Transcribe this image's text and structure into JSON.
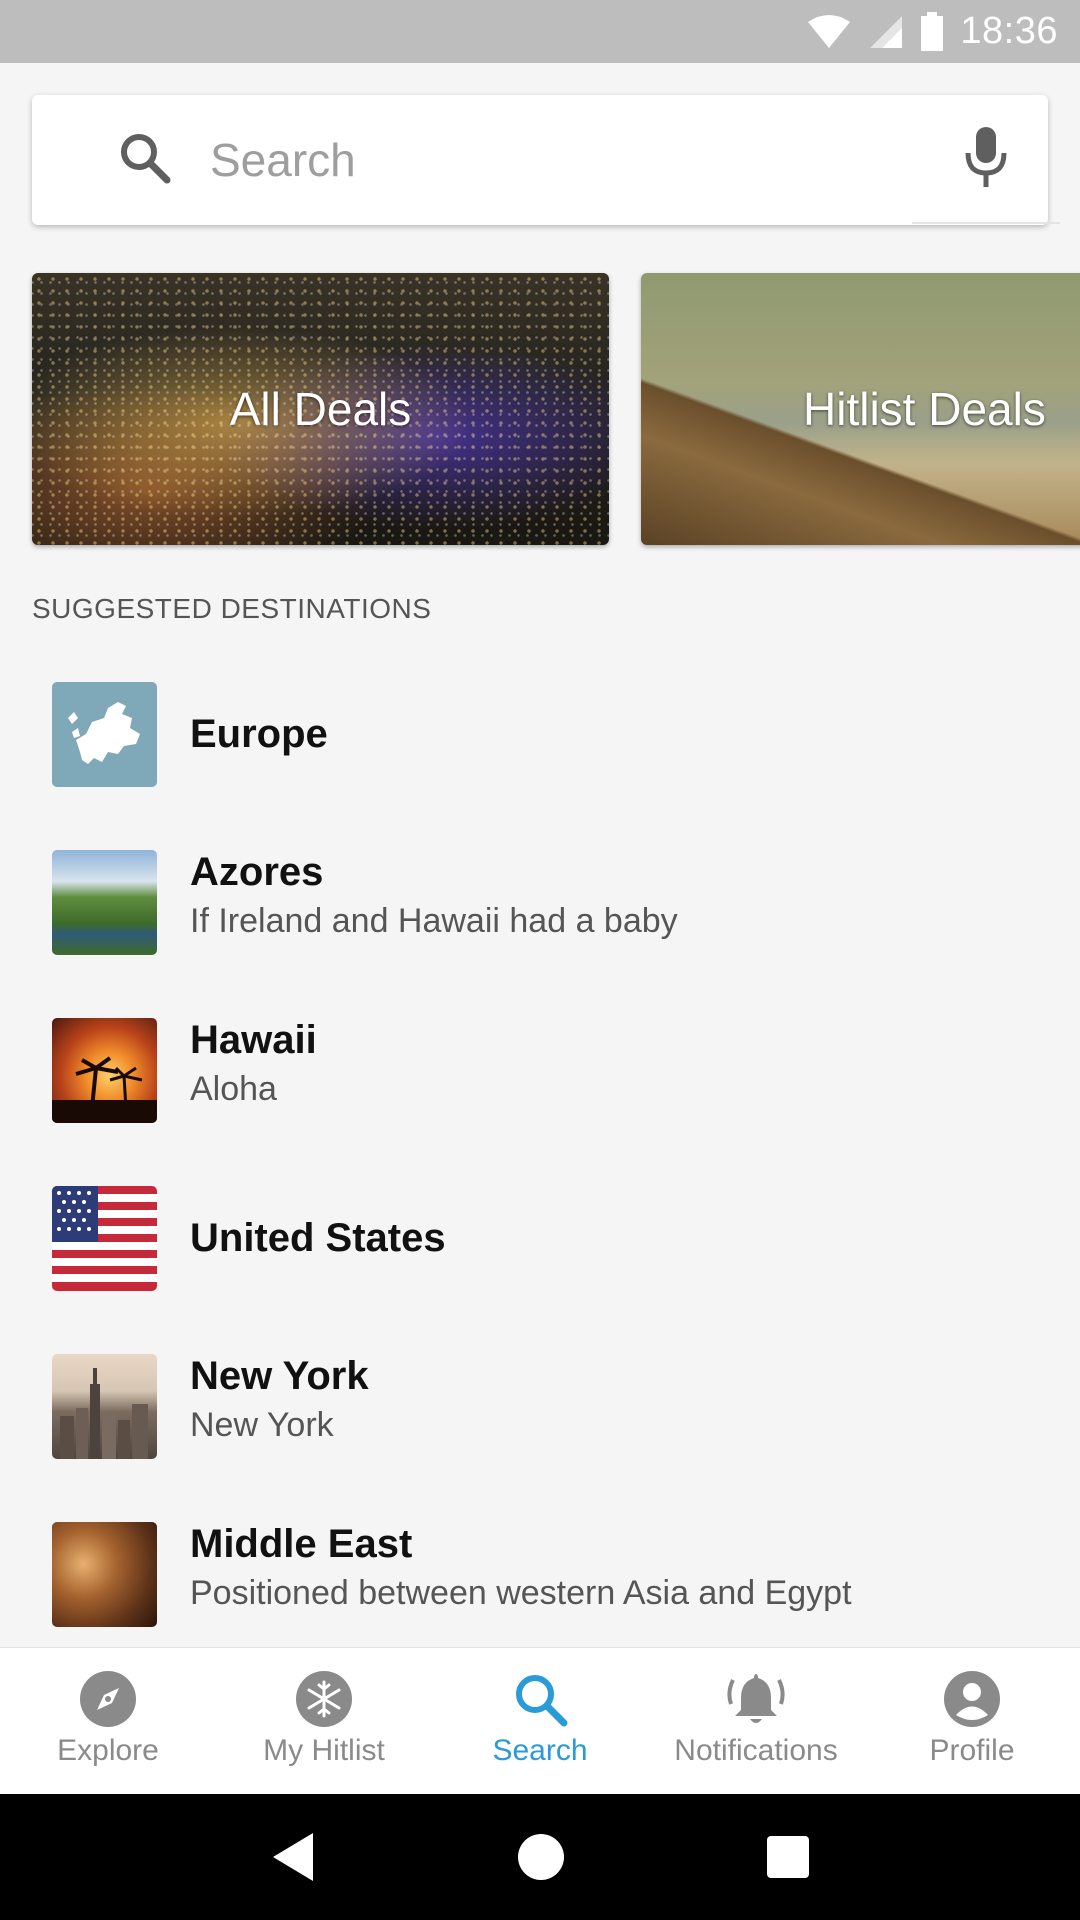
{
  "status_bar": {
    "time": "18:36"
  },
  "search": {
    "placeholder": "Search"
  },
  "deals": [
    {
      "label": "All Deals"
    },
    {
      "label": "Hitlist Deals"
    }
  ],
  "section_title": "SUGGESTED DESTINATIONS",
  "destinations": [
    {
      "name": "Europe",
      "subtitle": ""
    },
    {
      "name": "Azores",
      "subtitle": "If Ireland and Hawaii had a baby"
    },
    {
      "name": "Hawaii",
      "subtitle": "Aloha"
    },
    {
      "name": "United States",
      "subtitle": ""
    },
    {
      "name": "New York",
      "subtitle": "New York"
    },
    {
      "name": "Middle East",
      "subtitle": "Positioned between western Asia and Egypt"
    }
  ],
  "bottom_nav": {
    "items": [
      {
        "label": "Explore",
        "icon": "compass-icon"
      },
      {
        "label": "My Hitlist",
        "icon": "snowflake-icon"
      },
      {
        "label": "Search",
        "icon": "search-icon"
      },
      {
        "label": "Notifications",
        "icon": "bell-icon"
      },
      {
        "label": "Profile",
        "icon": "profile-icon"
      }
    ],
    "active": "Search"
  },
  "colors": {
    "accent": "#2a9bd6",
    "inactive": "#8a8a8a",
    "status_bar": "#bdbdbd"
  }
}
